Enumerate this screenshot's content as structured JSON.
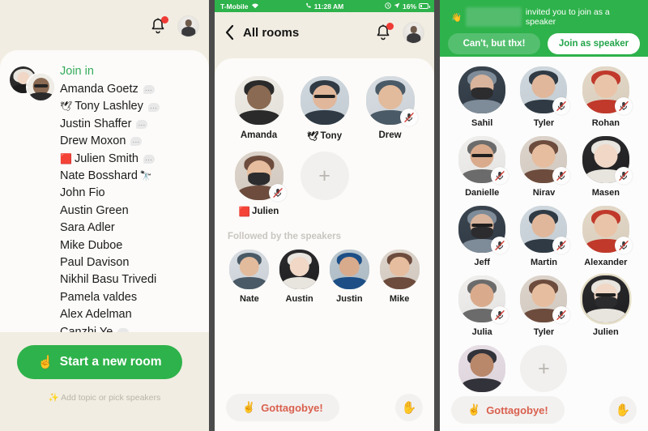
{
  "app": {
    "accent_green": "#2eb24b",
    "cream_bg": "#f1ede2",
    "leave_red": "#d9604f"
  },
  "left_panel": {
    "notification_badge": true,
    "join_in_label": "Join in",
    "people": [
      {
        "name": "Amanda Goetz",
        "prefix_emoji": "",
        "has_bubble": true
      },
      {
        "name": "Tony Lashley",
        "prefix_emoji": "🕊",
        "has_bubble": true
      },
      {
        "name": "Justin Shaffer",
        "prefix_emoji": "",
        "has_bubble": true
      },
      {
        "name": "Drew Moxon",
        "prefix_emoji": "",
        "has_bubble": true
      },
      {
        "name": "Julien Smith",
        "prefix_emoji": "🟥",
        "has_bubble": true
      },
      {
        "name": "Nate Bosshard",
        "prefix_emoji": "",
        "has_bubble": false,
        "suffix_emoji": "🔭"
      },
      {
        "name": "John Fio",
        "prefix_emoji": "",
        "has_bubble": false
      },
      {
        "name": "Austin Green",
        "prefix_emoji": "",
        "has_bubble": false
      },
      {
        "name": "Sara Adler",
        "prefix_emoji": "",
        "has_bubble": false
      },
      {
        "name": "Mike Duboe",
        "prefix_emoji": "",
        "has_bubble": false
      },
      {
        "name": "Paul Davison",
        "prefix_emoji": "",
        "has_bubble": false
      },
      {
        "name": "Nikhil Basu Trivedi",
        "prefix_emoji": "",
        "has_bubble": false
      },
      {
        "name": "Pamela valdes",
        "prefix_emoji": "",
        "has_bubble": false
      },
      {
        "name": "Alex Adelman",
        "prefix_emoji": "",
        "has_bubble": false
      },
      {
        "name": "Canzhi Ye",
        "prefix_emoji": "",
        "has_bubble": true
      }
    ],
    "start_room_label": "Start a new room",
    "start_room_emoji": "☝",
    "hint_label": "Add topic or pick speakers",
    "hint_emoji": "✨"
  },
  "mid_panel": {
    "status_bar": {
      "carrier": "T-Mobile",
      "wifi_icon": "wifi-icon",
      "time": "11:28 AM",
      "call_icon": "phone-icon",
      "alarm_icon": "alarm-icon",
      "location_icon": "location-arrow-icon",
      "battery": "16%"
    },
    "back_label": "All rooms",
    "notification_badge": true,
    "speakers": [
      {
        "name": "Amanda",
        "prefix_emoji": "",
        "muted": false
      },
      {
        "name": "Tony",
        "prefix_emoji": "🕊",
        "muted": false
      },
      {
        "name": "Drew",
        "prefix_emoji": "",
        "muted": true
      },
      {
        "name": "Julien",
        "prefix_emoji": "🟥",
        "muted": true
      }
    ],
    "add_speaker_label": "+",
    "followed_section_label": "Followed by the speakers",
    "followed": [
      {
        "name": "Nate"
      },
      {
        "name": "Austin"
      },
      {
        "name": "Justin"
      },
      {
        "name": "Mike"
      }
    ],
    "leave_label": "Gottagobye!",
    "leave_emoji": "✌",
    "raise_hand_emoji": "✋"
  },
  "right_panel": {
    "invite_text": "invited you to join as a speaker",
    "invite_name_redacted": "Austin Adams",
    "invite_emoji": "👋",
    "decline_label": "Can't, but thx!",
    "accept_label": "Join as speaker",
    "people": [
      {
        "name": "Sahil",
        "muted": false,
        "highlight": false
      },
      {
        "name": "Tyler",
        "muted": true,
        "highlight": false
      },
      {
        "name": "Rohan",
        "muted": true,
        "highlight": false
      },
      {
        "name": "Danielle",
        "muted": true,
        "highlight": false
      },
      {
        "name": "Nirav",
        "muted": true,
        "highlight": false
      },
      {
        "name": "Masen",
        "muted": true,
        "highlight": false
      },
      {
        "name": "Jeff",
        "muted": true,
        "highlight": false
      },
      {
        "name": "Martin",
        "muted": true,
        "highlight": false
      },
      {
        "name": "Alexander",
        "muted": true,
        "highlight": false
      },
      {
        "name": "Julia",
        "muted": true,
        "highlight": false
      },
      {
        "name": "Tyler",
        "muted": true,
        "highlight": false
      },
      {
        "name": "Julien",
        "muted": false,
        "highlight": true
      }
    ],
    "partial_row": [
      {
        "name": ""
      }
    ],
    "add_speaker_label": "+",
    "leave_label": "Gottagobye!",
    "leave_emoji": "✌",
    "raise_hand_emoji": "✋"
  }
}
